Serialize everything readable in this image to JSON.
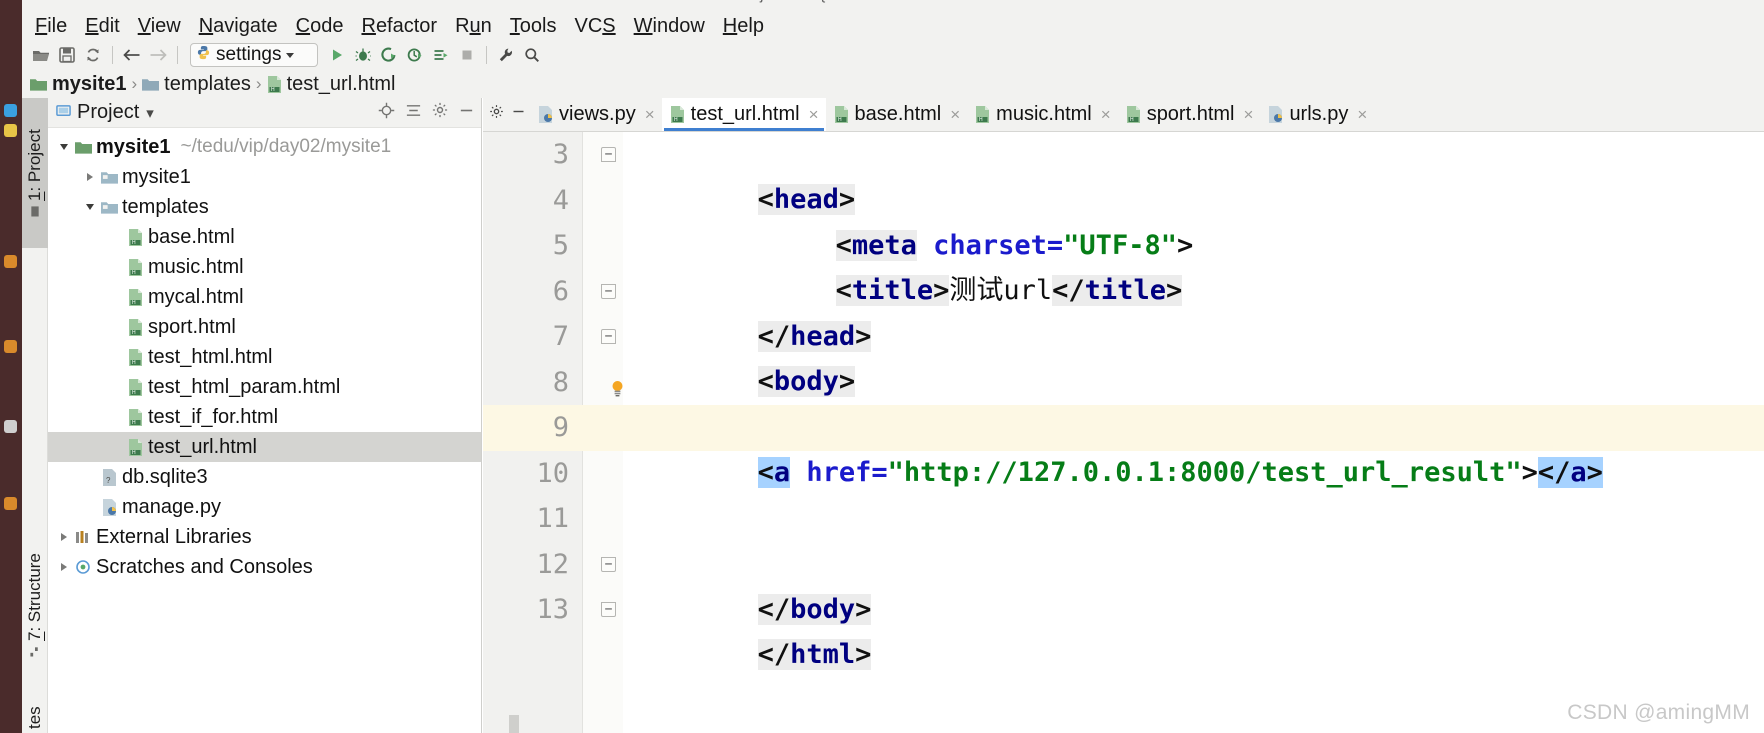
{
  "window": {
    "minimize_glyph": "—"
  },
  "menubar": {
    "items": [
      {
        "pre": "",
        "acc": "F",
        "post": "ile"
      },
      {
        "pre": "",
        "acc": "E",
        "post": "dit"
      },
      {
        "pre": "",
        "acc": "V",
        "post": "iew"
      },
      {
        "pre": "",
        "acc": "N",
        "post": "avigate"
      },
      {
        "pre": "",
        "acc": "C",
        "post": "ode"
      },
      {
        "pre": "",
        "acc": "R",
        "post": "efactor"
      },
      {
        "pre": "R",
        "acc": "u",
        "post": "n"
      },
      {
        "pre": "",
        "acc": "T",
        "post": "ools"
      },
      {
        "pre": "VC",
        "acc": "S",
        "post": ""
      },
      {
        "pre": "",
        "acc": "W",
        "post": "indow"
      },
      {
        "pre": "",
        "acc": "H",
        "post": "elp"
      }
    ]
  },
  "toolbar": {
    "open_icon": "open-folder-icon",
    "save_icon": "save-icon",
    "sync_icon": "sync-icon",
    "back_icon": "back-arrow-icon",
    "forward_icon": "forward-arrow-icon",
    "run_config_label": "settings",
    "run_config_icon": "python-file-icon",
    "run_icon": "run-icon",
    "debug_icon": "debug-icon",
    "run_coverage_icon": "run-with-coverage-icon",
    "profile_icon": "profile-icon",
    "attach_icon": "attach-to-process-icon",
    "stop_icon": "stop-icon",
    "settings_icon": "wrench-settings-icon",
    "search_icon": "search-icon"
  },
  "breadcrumb": {
    "items": [
      {
        "label": "mysite1",
        "icon": "folder-icon",
        "bold": true
      },
      {
        "label": "templates",
        "icon": "folder-icon",
        "bold": false
      },
      {
        "label": "test_url.html",
        "icon": "html-file-icon",
        "bold": false
      }
    ],
    "separator": "›"
  },
  "toolwindow_tabs": {
    "left": [
      {
        "pre": "",
        "acc": "1",
        "post": ": Project",
        "icon": "project-icon",
        "active": true
      },
      {
        "pre": "",
        "acc": "7",
        "post": ": Structure",
        "icon": "structure-icon",
        "active": false
      },
      {
        "pre": "",
        "acc": "",
        "post": "tes",
        "icon": "",
        "active": false
      }
    ]
  },
  "project_panel": {
    "title": "Project",
    "caret": "▾",
    "locate_icon": "locate-target-icon",
    "collapse_icon": "collapse-all-icon",
    "hide_icon": "hide-panel-icon",
    "settings_icon": "gear-icon",
    "tree": [
      {
        "label": "mysite1",
        "path": "~/tedu/vip/day02/mysite1",
        "icon": "folder-icon",
        "arrow": "open",
        "indent": 0,
        "bold": true,
        "selected": false
      },
      {
        "label": "mysite1",
        "path": "",
        "icon": "module-folder-icon",
        "arrow": "closed",
        "indent": 1,
        "bold": false,
        "selected": false
      },
      {
        "label": "templates",
        "path": "",
        "icon": "module-folder-icon",
        "arrow": "open",
        "indent": 1,
        "bold": false,
        "selected": false
      },
      {
        "label": "base.html",
        "path": "",
        "icon": "html-file-icon",
        "arrow": "none",
        "indent": 2,
        "bold": false,
        "selected": false
      },
      {
        "label": "music.html",
        "path": "",
        "icon": "html-file-icon",
        "arrow": "none",
        "indent": 2,
        "bold": false,
        "selected": false
      },
      {
        "label": "mycal.html",
        "path": "",
        "icon": "html-file-icon",
        "arrow": "none",
        "indent": 2,
        "bold": false,
        "selected": false
      },
      {
        "label": "sport.html",
        "path": "",
        "icon": "html-file-icon",
        "arrow": "none",
        "indent": 2,
        "bold": false,
        "selected": false
      },
      {
        "label": "test_html.html",
        "path": "",
        "icon": "html-file-icon",
        "arrow": "none",
        "indent": 2,
        "bold": false,
        "selected": false
      },
      {
        "label": "test_html_param.html",
        "path": "",
        "icon": "html-file-icon",
        "arrow": "none",
        "indent": 2,
        "bold": false,
        "selected": false
      },
      {
        "label": "test_if_for.html",
        "path": "",
        "icon": "html-file-icon",
        "arrow": "none",
        "indent": 2,
        "bold": false,
        "selected": false
      },
      {
        "label": "test_url.html",
        "path": "",
        "icon": "html-file-icon",
        "arrow": "none",
        "indent": 2,
        "bold": false,
        "selected": true
      },
      {
        "label": "db.sqlite3",
        "path": "",
        "icon": "db-file-icon",
        "arrow": "none",
        "indent": 1,
        "bold": false,
        "selected": false
      },
      {
        "label": "manage.py",
        "path": "",
        "icon": "python-file-icon",
        "arrow": "none",
        "indent": 1,
        "bold": false,
        "selected": false
      },
      {
        "label": "External Libraries",
        "path": "",
        "icon": "libraries-icon",
        "arrow": "closed",
        "indent": 0,
        "bold": false,
        "selected": false
      },
      {
        "label": "Scratches and Consoles",
        "path": "",
        "icon": "scratches-icon",
        "arrow": "closed",
        "indent": 0,
        "bold": false,
        "selected": false
      }
    ]
  },
  "editor": {
    "tabs": [
      {
        "label": "views.py",
        "icon": "python-file-icon",
        "active": false,
        "close": "×"
      },
      {
        "label": "test_url.html",
        "icon": "html-file-icon",
        "active": true,
        "close": "×"
      },
      {
        "label": "base.html",
        "icon": "html-file-icon",
        "active": false,
        "close": "×"
      },
      {
        "label": "music.html",
        "icon": "html-file-icon",
        "active": false,
        "close": "×"
      },
      {
        "label": "sport.html",
        "icon": "html-file-icon",
        "active": false,
        "close": "×"
      },
      {
        "label": "urls.py",
        "icon": "python-file-icon",
        "active": false,
        "close": "×"
      }
    ],
    "tab_settings_icon": "gear-icon",
    "tab_hide_icon": "minimize-icon",
    "lines": [
      {
        "num": "3",
        "fold": "start",
        "highlight": false
      },
      {
        "num": "4",
        "fold": "none",
        "highlight": false
      },
      {
        "num": "5",
        "fold": "none",
        "highlight": false
      },
      {
        "num": "6",
        "fold": "end",
        "highlight": false
      },
      {
        "num": "7",
        "fold": "start",
        "highlight": false
      },
      {
        "num": "8",
        "fold": "none",
        "highlight": false
      },
      {
        "num": "9",
        "fold": "none",
        "highlight": true
      },
      {
        "num": "10",
        "fold": "none",
        "highlight": false
      },
      {
        "num": "11",
        "fold": "none",
        "highlight": false
      },
      {
        "num": "12",
        "fold": "end",
        "highlight": false
      },
      {
        "num": "13",
        "fold": "end",
        "highlight": false
      }
    ],
    "code_text": {
      "l3": "<head>",
      "l4_open": "<meta ",
      "l4_attr": "charset=",
      "l4_str": "\"UTF-8\"",
      "l4_close": ">",
      "l5_open": "<title>",
      "l5_text": "测试url",
      "l5_close": "</title>",
      "l6": "</head>",
      "l7": "<body>",
      "l9_a": "<a",
      "l9_space": " ",
      "l9_attr": "href=",
      "l9_str": "\"http://127.0.0.1:8000/test_url_result\"",
      "l9_gt": ">",
      "l9_end": "</a>",
      "l12": "</body>",
      "l13": "</html>"
    },
    "intention_icon": "lightbulb-icon"
  },
  "watermark": "CSDN @amingMM",
  "colors": {
    "accent_tab_underline": "#3f7fd0",
    "tag": "#000080",
    "attribute": "#1b1bcc",
    "string": "#067d17",
    "selection": "#a6d2ff",
    "current_line": "#fdf8e4",
    "tree_selection": "#d4d4d1"
  }
}
